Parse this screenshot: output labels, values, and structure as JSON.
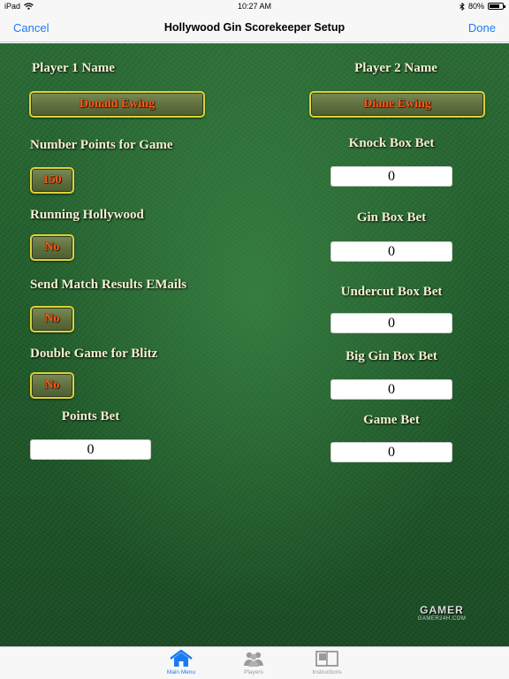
{
  "status": {
    "device": "iPad",
    "time": "10:27 AM",
    "battery": "80%",
    "battery_level": 0.8
  },
  "nav": {
    "cancel": "Cancel",
    "title": "Hollywood Gin Scorekeeper Setup",
    "done": "Done"
  },
  "left": {
    "player1_label": "Player 1 Name",
    "player1_name": "Donald Ewing",
    "points_label": "Number Points for Game",
    "points_value": "150",
    "running_label": "Running Hollywood",
    "running_value": "No",
    "emails_label": "Send Match Results EMails",
    "emails_value": "No",
    "blitz_label": "Double Game for Blitz",
    "blitz_value": "No",
    "points_bet_label": "Points Bet",
    "points_bet_value": "0"
  },
  "right": {
    "player2_label": "Player 2 Name",
    "player2_name": "Diane Ewing",
    "knock_label": "Knock Box Bet",
    "knock_value": "0",
    "gin_label": "Gin Box Bet",
    "gin_value": "0",
    "undercut_label": "Undercut Box Bet",
    "undercut_value": "0",
    "big_gin_label": "Big Gin Box Bet",
    "big_gin_value": "0",
    "game_label": "Game Bet",
    "game_value": "0"
  },
  "watermark": {
    "main": "GAMER",
    "sub": "GAMER24H.COM"
  },
  "tabs": [
    {
      "label": "Main Menu",
      "icon": "home-icon",
      "active": true
    },
    {
      "label": "Players",
      "icon": "players-icon",
      "active": false
    },
    {
      "label": "Instructions",
      "icon": "book-icon",
      "active": false
    }
  ],
  "colors": {
    "accent": "#1a7cf0",
    "felt": "#1f5a2a",
    "button_text": "#ff5a1a",
    "button_border": "#d9d23a"
  }
}
